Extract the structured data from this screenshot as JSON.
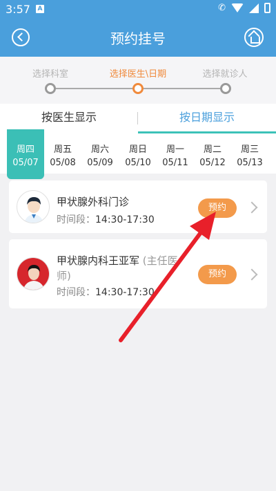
{
  "status_bar": {
    "time": "3:57",
    "notif_letter": "A"
  },
  "header": {
    "title": "预约挂号"
  },
  "steps": [
    {
      "label": "选择科室",
      "active": false
    },
    {
      "label": "选择医生\\日期",
      "active": true
    },
    {
      "label": "选择就诊人",
      "active": false
    }
  ],
  "tabs": [
    {
      "label": "按医生显示",
      "active": false
    },
    {
      "label": "按日期显示",
      "active": true
    }
  ],
  "dates": [
    {
      "weekday": "周四",
      "date": "05/07",
      "active": true
    },
    {
      "weekday": "周五",
      "date": "05/08",
      "active": false
    },
    {
      "weekday": "周六",
      "date": "05/09",
      "active": false
    },
    {
      "weekday": "周日",
      "date": "05/10",
      "active": false
    },
    {
      "weekday": "周一",
      "date": "05/11",
      "active": false
    },
    {
      "weekday": "周二",
      "date": "05/12",
      "active": false
    },
    {
      "weekday": "周三",
      "date": "05/13",
      "active": false
    }
  ],
  "doctors": [
    {
      "name": "甲状腺外科门诊",
      "title_suffix": "",
      "time_label": "时间段：",
      "time_value": "14:30-17:30",
      "book_label": "预约"
    },
    {
      "name": "甲状腺内科王亚军",
      "title_suffix": "(主任医",
      "title_suffix2": "师)",
      "time_label": "时间段：",
      "time_value": "14:30-17:30",
      "book_label": "预约"
    }
  ],
  "colors": {
    "header": "#4a9fdc",
    "accent_teal": "#3bbfb6",
    "accent_orange": "#f39a4b",
    "annotation_red": "#e8202a"
  }
}
